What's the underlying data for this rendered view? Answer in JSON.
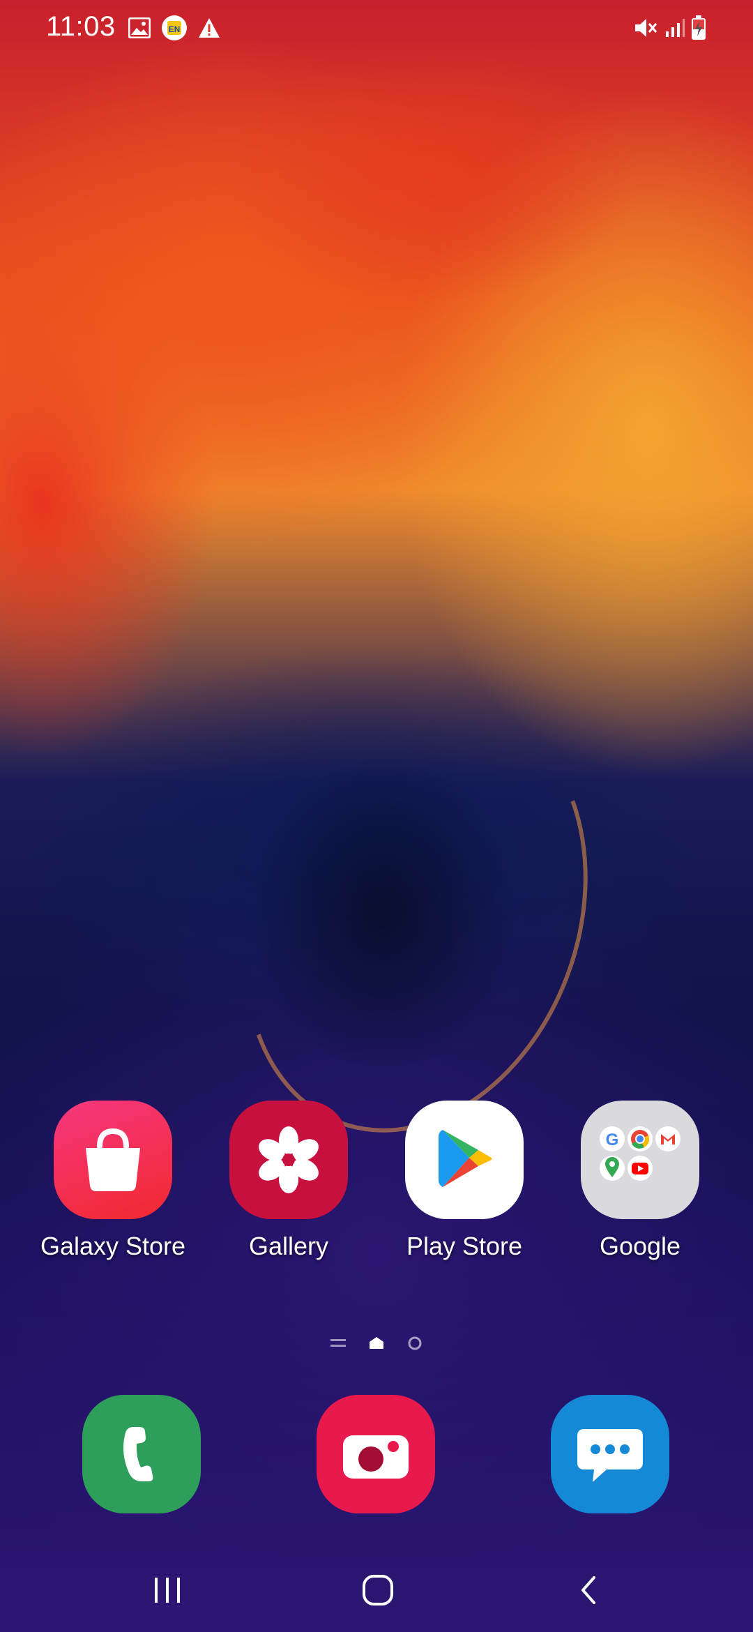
{
  "status_bar": {
    "time": "11:03",
    "left_icons": [
      "image-notification-icon",
      "app-notification-icon",
      "warning-icon"
    ],
    "right_icons": [
      "mute-icon",
      "signal-icon",
      "battery-charging-icon"
    ]
  },
  "home_apps": [
    {
      "label": "Galaxy Store",
      "icon": "galaxy-store-icon",
      "color": "#f02a58"
    },
    {
      "label": "Gallery",
      "icon": "gallery-icon",
      "color": "#c8103f"
    },
    {
      "label": "Play Store",
      "icon": "play-store-icon",
      "color": "#ffffff"
    },
    {
      "label": "Google",
      "icon": "google-folder-icon",
      "color": "#d9d9de"
    }
  ],
  "page_indicator": [
    "menu-page-icon",
    "home-page-icon",
    "page-dot-icon"
  ],
  "dock_apps": [
    {
      "name": "Phone",
      "icon": "phone-icon",
      "color": "#2e9e5b"
    },
    {
      "name": "Camera",
      "icon": "camera-icon",
      "color": "#e8194d"
    },
    {
      "name": "Messages",
      "icon": "messages-icon",
      "color": "#1589d6"
    }
  ],
  "nav_bar": [
    "recent-apps-icon",
    "home-icon",
    "back-icon"
  ]
}
